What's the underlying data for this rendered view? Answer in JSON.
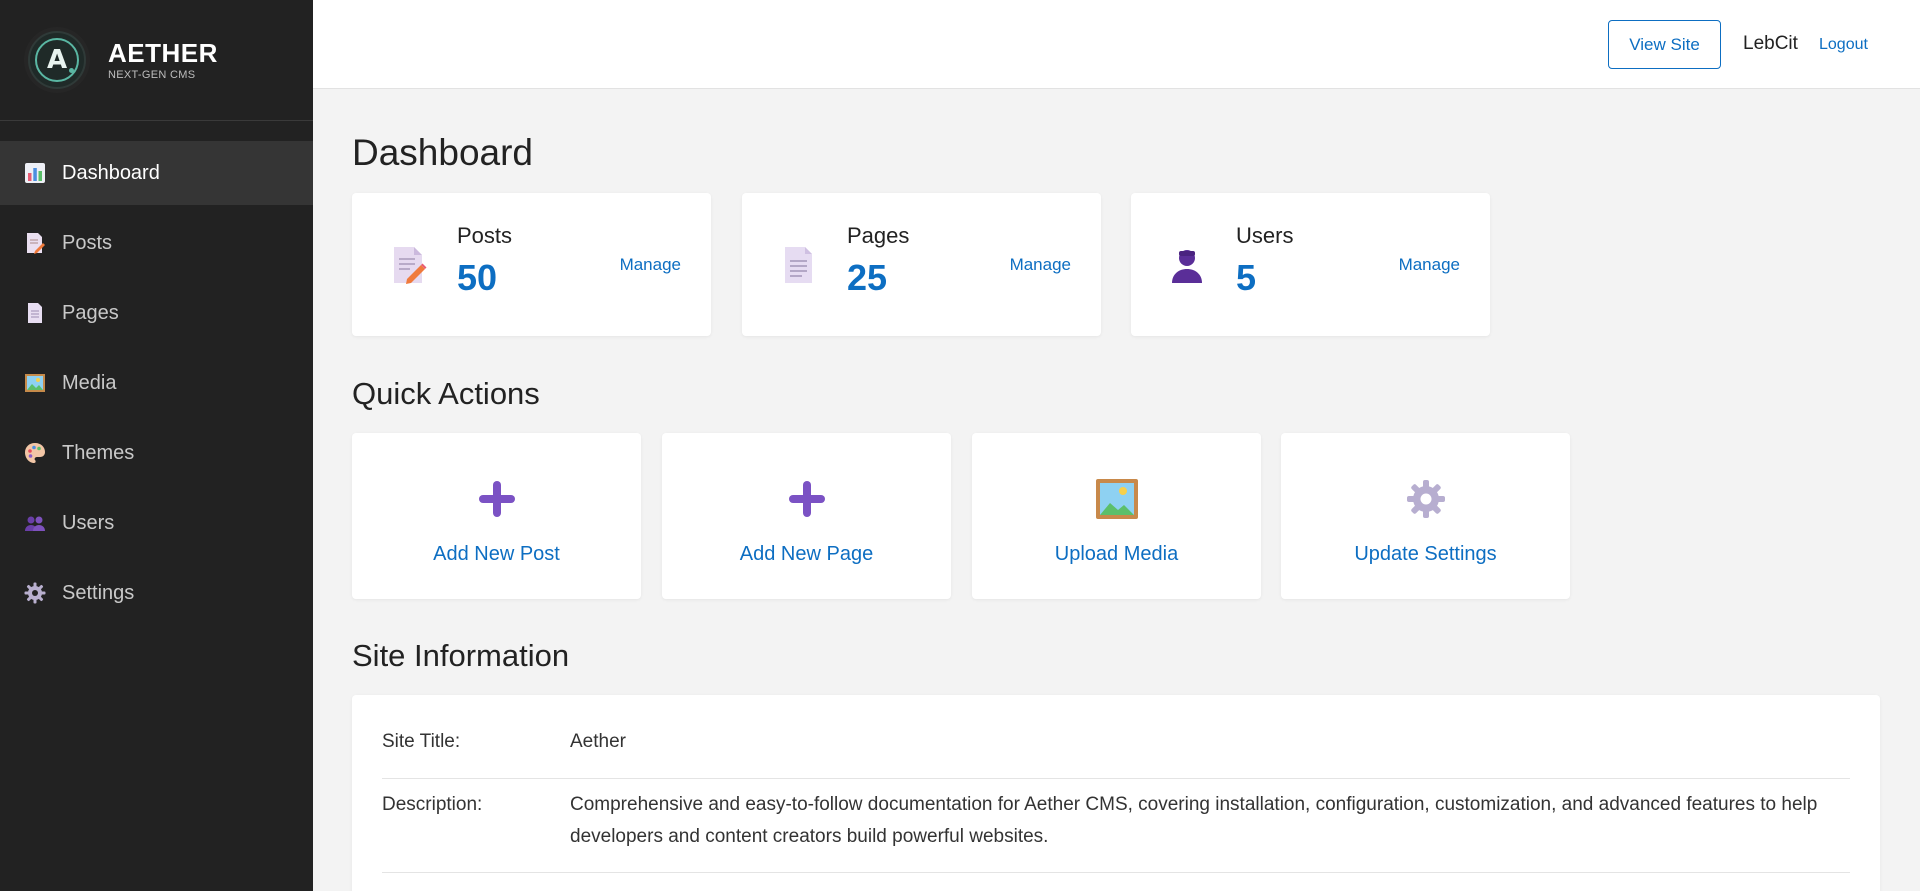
{
  "brand": {
    "logo_letter": "A",
    "name": "AETHER",
    "tagline": "NEXT-GEN CMS"
  },
  "sidebar": {
    "items": [
      {
        "label": "Dashboard",
        "icon": "bar-chart-icon",
        "active": true
      },
      {
        "label": "Posts",
        "icon": "memo-icon",
        "active": false
      },
      {
        "label": "Pages",
        "icon": "page-icon",
        "active": false
      },
      {
        "label": "Media",
        "icon": "picture-icon",
        "active": false
      },
      {
        "label": "Themes",
        "icon": "palette-icon",
        "active": false
      },
      {
        "label": "Users",
        "icon": "users-icon",
        "active": false
      },
      {
        "label": "Settings",
        "icon": "gear-icon",
        "active": false
      }
    ]
  },
  "topbar": {
    "view_site": "View Site",
    "username": "LebCit",
    "logout": "Logout"
  },
  "dashboard": {
    "title": "Dashboard",
    "stats": [
      {
        "label": "Posts",
        "value": "50",
        "manage": "Manage",
        "icon": "memo-icon"
      },
      {
        "label": "Pages",
        "value": "25",
        "manage": "Manage",
        "icon": "page-icon"
      },
      {
        "label": "Users",
        "value": "5",
        "manage": "Manage",
        "icon": "user-silhouette-icon"
      }
    ]
  },
  "quick_actions": {
    "title": "Quick Actions",
    "items": [
      {
        "label": "Add New Post",
        "icon": "plus-icon"
      },
      {
        "label": "Add New Page",
        "icon": "plus-icon"
      },
      {
        "label": "Upload Media",
        "icon": "picture-icon"
      },
      {
        "label": "Update Settings",
        "icon": "gear-icon"
      }
    ]
  },
  "site_info": {
    "title": "Site Information",
    "rows": [
      {
        "key": "Site Title:",
        "value": "Aether"
      },
      {
        "key": "Description:",
        "value": "Comprehensive and easy-to-follow documentation for Aether CMS, covering installation, configuration, customization, and advanced features to help developers and content creators build powerful websites."
      }
    ]
  },
  "colors": {
    "sidebar_bg": "#222222",
    "accent": "#0d6ec2",
    "page_bg": "#f3f3f3",
    "brand_ring": "#5ab7a3"
  }
}
